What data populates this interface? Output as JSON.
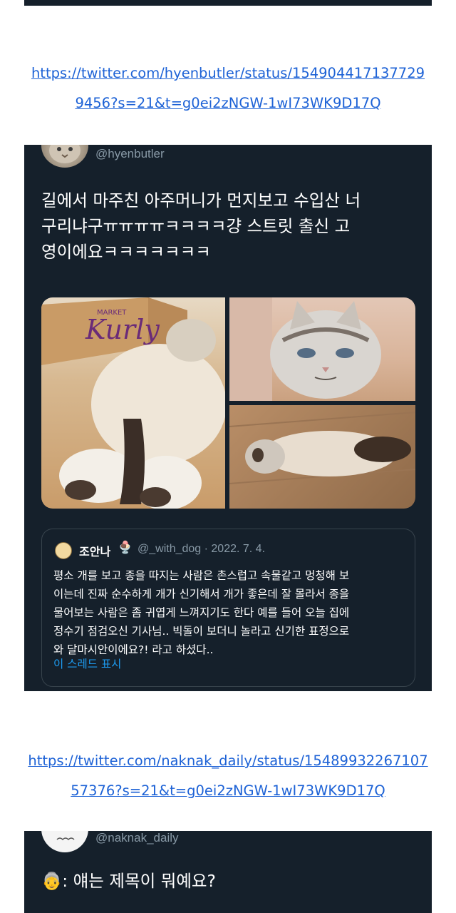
{
  "links": [
    {
      "line1": "https://twitter.com/hyenbutler/status/154904417137729",
      "line2": "9456?s=21&t=g0ei2zNGW-1wI73WK9D17Q"
    },
    {
      "line1": "https://twitter.com/naknak_daily/status/15489932267107",
      "line2": "57376?s=21&t=g0ei2zNGW-1wI73WK9D17Q"
    }
  ],
  "tweet1": {
    "handle": "@hyenbutler",
    "text_lines": [
      "길에서 마주친 아주머니가 먼지보고 수입산 너",
      "구리냐구ㅠㅠㅠㅠㅋㅋㅋㅋ걍 스트릿 출신 고",
      "영이에요ㅋㅋㅋㅋㅋㅋㅋ"
    ],
    "photos": [
      {
        "name": "cat-lying-on-floor-photo",
        "box_text": "Kurly",
        "box_sub": "MARKET"
      },
      {
        "name": "grumpy-cat-face-photo"
      },
      {
        "name": "cat-stretched-out-photo"
      }
    ],
    "quote": {
      "name": "조안나",
      "emoji": "🍨",
      "meta": "@_with_dog · 2022. 7. 4.",
      "text_lines": [
        "평소 개를 보고 종을 따지는 사람은 촌스럽고 속물같고 멍청해 보",
        "이는데 진짜 순수하게 개가 신기해서 개가 좋은데 잘 몰라서 종을",
        "물어보는 사람은 좀 귀엽게 느껴지기도 한다 예를 들어 오늘 집에",
        "정수기 점검오신 기사님.. 빅돌이 보더니 놀라고 신기한 표정으로",
        "와 달마시안이에요?! 라고 하셨다.."
      ],
      "show_thread": "이 스레드 표시"
    }
  },
  "tweet2": {
    "handle": "@naknak_daily",
    "emoji": "👵",
    "text_line1": ": 얘는 제목이 뭐예요?"
  },
  "colors": {
    "tweet_bg": "#15202b",
    "link": "#1d62d6",
    "muted": "#8899a6",
    "accent": "#1d9bf0"
  }
}
